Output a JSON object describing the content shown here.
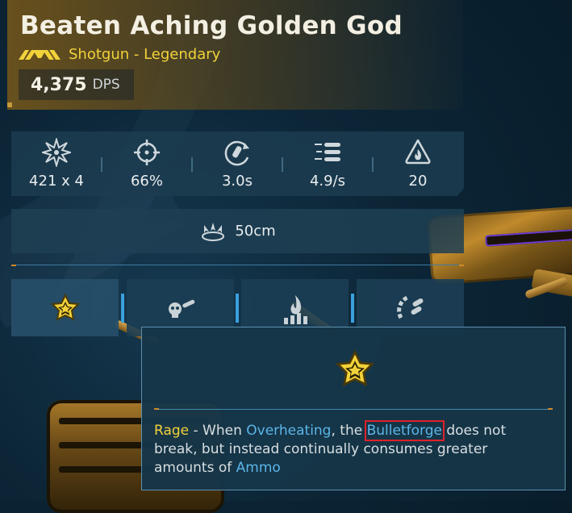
{
  "weapon": {
    "name": "Beaten Aching Golden God",
    "rarity_icon": "legendary-chevrons-icon",
    "rarity_label": "Shotgun - Legendary",
    "dps_value": "4,375",
    "dps_unit": "DPS"
  },
  "stats": [
    {
      "icon": "damage-burst-icon",
      "value": "421 x 4"
    },
    {
      "icon": "crosshair-icon",
      "value": "66%"
    },
    {
      "icon": "reload-icon",
      "value": "3.0s"
    },
    {
      "icon": "fire-rate-icon",
      "value": "4.9/s"
    },
    {
      "icon": "magazine-flame-icon",
      "value": "20"
    }
  ],
  "range": {
    "icon": "spread-range-icon",
    "value": "50cm"
  },
  "mod_tabs": [
    {
      "icon": "star-badge-icon",
      "active": true
    },
    {
      "icon": "skull-bullet-icon",
      "active": false
    },
    {
      "icon": "flame-bars-icon",
      "active": false
    },
    {
      "icon": "ammo-arc-icon",
      "active": false
    }
  ],
  "tooltip": {
    "icon": "star-badge-icon",
    "segments": [
      {
        "text": "Rage",
        "style": "yellow"
      },
      {
        "text": " - When ",
        "style": "plain"
      },
      {
        "text": "Overheating",
        "style": "blue"
      },
      {
        "text": ", the ",
        "style": "plain"
      },
      {
        "text": "Bulletforge",
        "style": "blue-boxed"
      },
      {
        "text": " does not break, but instead continually consumes greater amounts of ",
        "style": "plain"
      },
      {
        "text": "Ammo",
        "style": "blue"
      }
    ]
  },
  "colors": {
    "accent_yellow": "#f2d23a",
    "keyword_blue": "#5bb6e8",
    "highlight_red": "#e0202a",
    "panel": "#1c3c50"
  }
}
